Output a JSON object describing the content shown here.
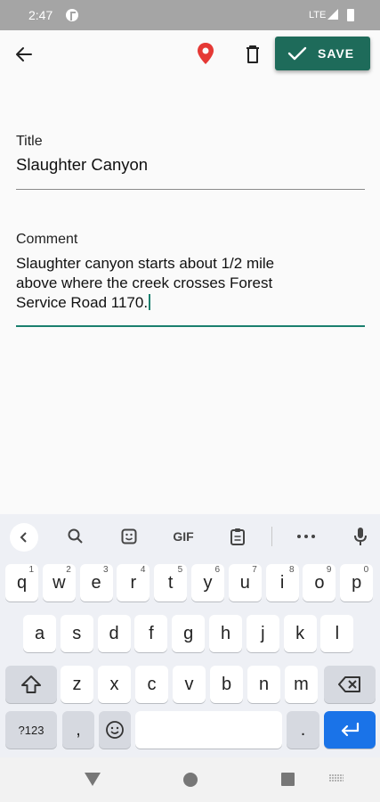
{
  "status_bar": {
    "time": "2:47",
    "network": "LTE"
  },
  "toolbar": {
    "save_label": "SAVE",
    "accent_color": "#1e6b5a",
    "pin_color": "#e53935"
  },
  "title_field": {
    "label": "Title",
    "value": "Slaughter Canyon"
  },
  "comment_field": {
    "label": "Comment",
    "lines": [
      "Slaughter canyon starts about 1/2 mile",
      "above where the creek crosses Forest",
      "Service Road 1170."
    ]
  },
  "keyboard": {
    "toolbar": {
      "gif_label": "GIF"
    },
    "row1": [
      {
        "key": "q",
        "hint": "1"
      },
      {
        "key": "w",
        "hint": "2"
      },
      {
        "key": "e",
        "hint": "3"
      },
      {
        "key": "r",
        "hint": "4"
      },
      {
        "key": "t",
        "hint": "5"
      },
      {
        "key": "y",
        "hint": "6"
      },
      {
        "key": "u",
        "hint": "7"
      },
      {
        "key": "i",
        "hint": "8"
      },
      {
        "key": "o",
        "hint": "9"
      },
      {
        "key": "p",
        "hint": "0"
      }
    ],
    "row2": [
      "a",
      "s",
      "d",
      "f",
      "g",
      "h",
      "j",
      "k",
      "l"
    ],
    "row3": [
      "z",
      "x",
      "c",
      "v",
      "b",
      "n",
      "m"
    ],
    "symbols_label": "?123",
    "comma_label": ",",
    "period_label": "."
  }
}
